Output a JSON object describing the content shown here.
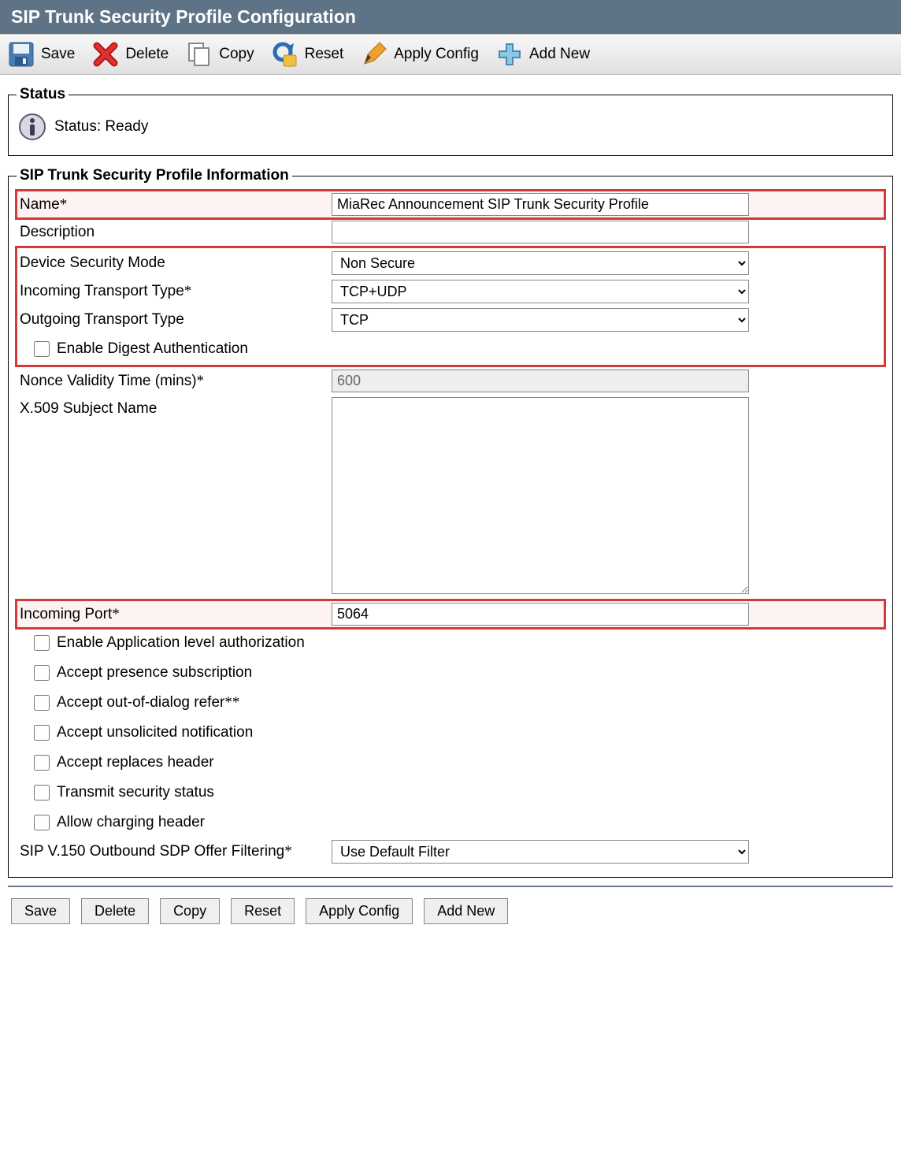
{
  "header": {
    "title": "SIP Trunk Security Profile Configuration"
  },
  "toolbar": {
    "save": "Save",
    "delete": "Delete",
    "copy": "Copy",
    "reset": "Reset",
    "apply": "Apply Config",
    "addnew": "Add New"
  },
  "status": {
    "legend": "Status",
    "text": "Status: Ready"
  },
  "form": {
    "legend": "SIP Trunk Security Profile Information",
    "name_label": "Name",
    "name_value": "MiaRec Announcement SIP Trunk Security Profile",
    "description_label": "Description",
    "description_value": "",
    "devmode_label": "Device Security Mode",
    "devmode_value": "Non Secure",
    "intrans_label": "Incoming Transport Type",
    "intrans_value": "TCP+UDP",
    "outtrans_label": "Outgoing Transport Type",
    "outtrans_value": "TCP",
    "digest_label": "Enable Digest Authentication",
    "nonce_label": "Nonce Validity Time (mins)",
    "nonce_value": "600",
    "x509_label": "X.509 Subject Name",
    "x509_value": "",
    "inport_label": "Incoming Port",
    "inport_value": "5064",
    "chk_applevel": "Enable Application level authorization",
    "chk_presence": "Accept presence subscription",
    "chk_refer": "Accept out-of-dialog refer",
    "chk_unsol": "Accept unsolicited notification",
    "chk_replaces": "Accept replaces header",
    "chk_transmit": "Transmit security status",
    "chk_charging": "Allow charging header",
    "sdpfilter_label": "SIP V.150 Outbound SDP Offer Filtering",
    "sdpfilter_value": "Use Default Filter"
  },
  "buttons": {
    "save": "Save",
    "delete": "Delete",
    "copy": "Copy",
    "reset": "Reset",
    "apply": "Apply Config",
    "addnew": "Add New"
  }
}
